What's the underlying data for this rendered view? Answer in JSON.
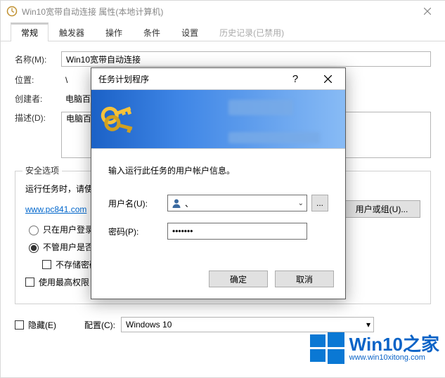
{
  "window": {
    "title": "Win10宽带自动连接 属性(本地计算机)"
  },
  "tabs": {
    "items": [
      {
        "label": "常规",
        "active": true
      },
      {
        "label": "触发器"
      },
      {
        "label": "操作"
      },
      {
        "label": "条件"
      },
      {
        "label": "设置"
      },
      {
        "label": "历史记录(已禁用)",
        "disabled": true
      }
    ]
  },
  "form": {
    "name_label": "名称(M):",
    "name_value": "Win10宽带自动连接",
    "location_label": "位置:",
    "location_value": "\\",
    "creator_label": "创建者:",
    "creator_value": "电脑百",
    "desc_label": "描述(D):",
    "desc_value": "电脑百"
  },
  "security": {
    "legend": "安全选项",
    "run_when_label": "运行任务时，请使",
    "link_text": "www.pc841.com",
    "opt_only_logged": "只在用户登录",
    "opt_any_user": "不管用户是否登",
    "opt_no_store_pw": "不存储密码",
    "opt_highest_priv": "使用最高权限",
    "change_user_btn": "用户或组(U)..."
  },
  "bottom": {
    "hidden_label": "隐藏(E)",
    "config_label": "配置(C):",
    "config_value": "Windows 10"
  },
  "dialog": {
    "title": "任务计划程序",
    "prompt": "输入运行此任务的用户帐户信息。",
    "user_label": "用户名(U):",
    "user_value": "、",
    "pass_label": "密码(P):",
    "pass_value": "•••••••",
    "browse_label": "...",
    "ok": "确定",
    "cancel": "取消"
  },
  "watermark": {
    "text": "Win10之家",
    "site": "www.win10xitong.com"
  }
}
